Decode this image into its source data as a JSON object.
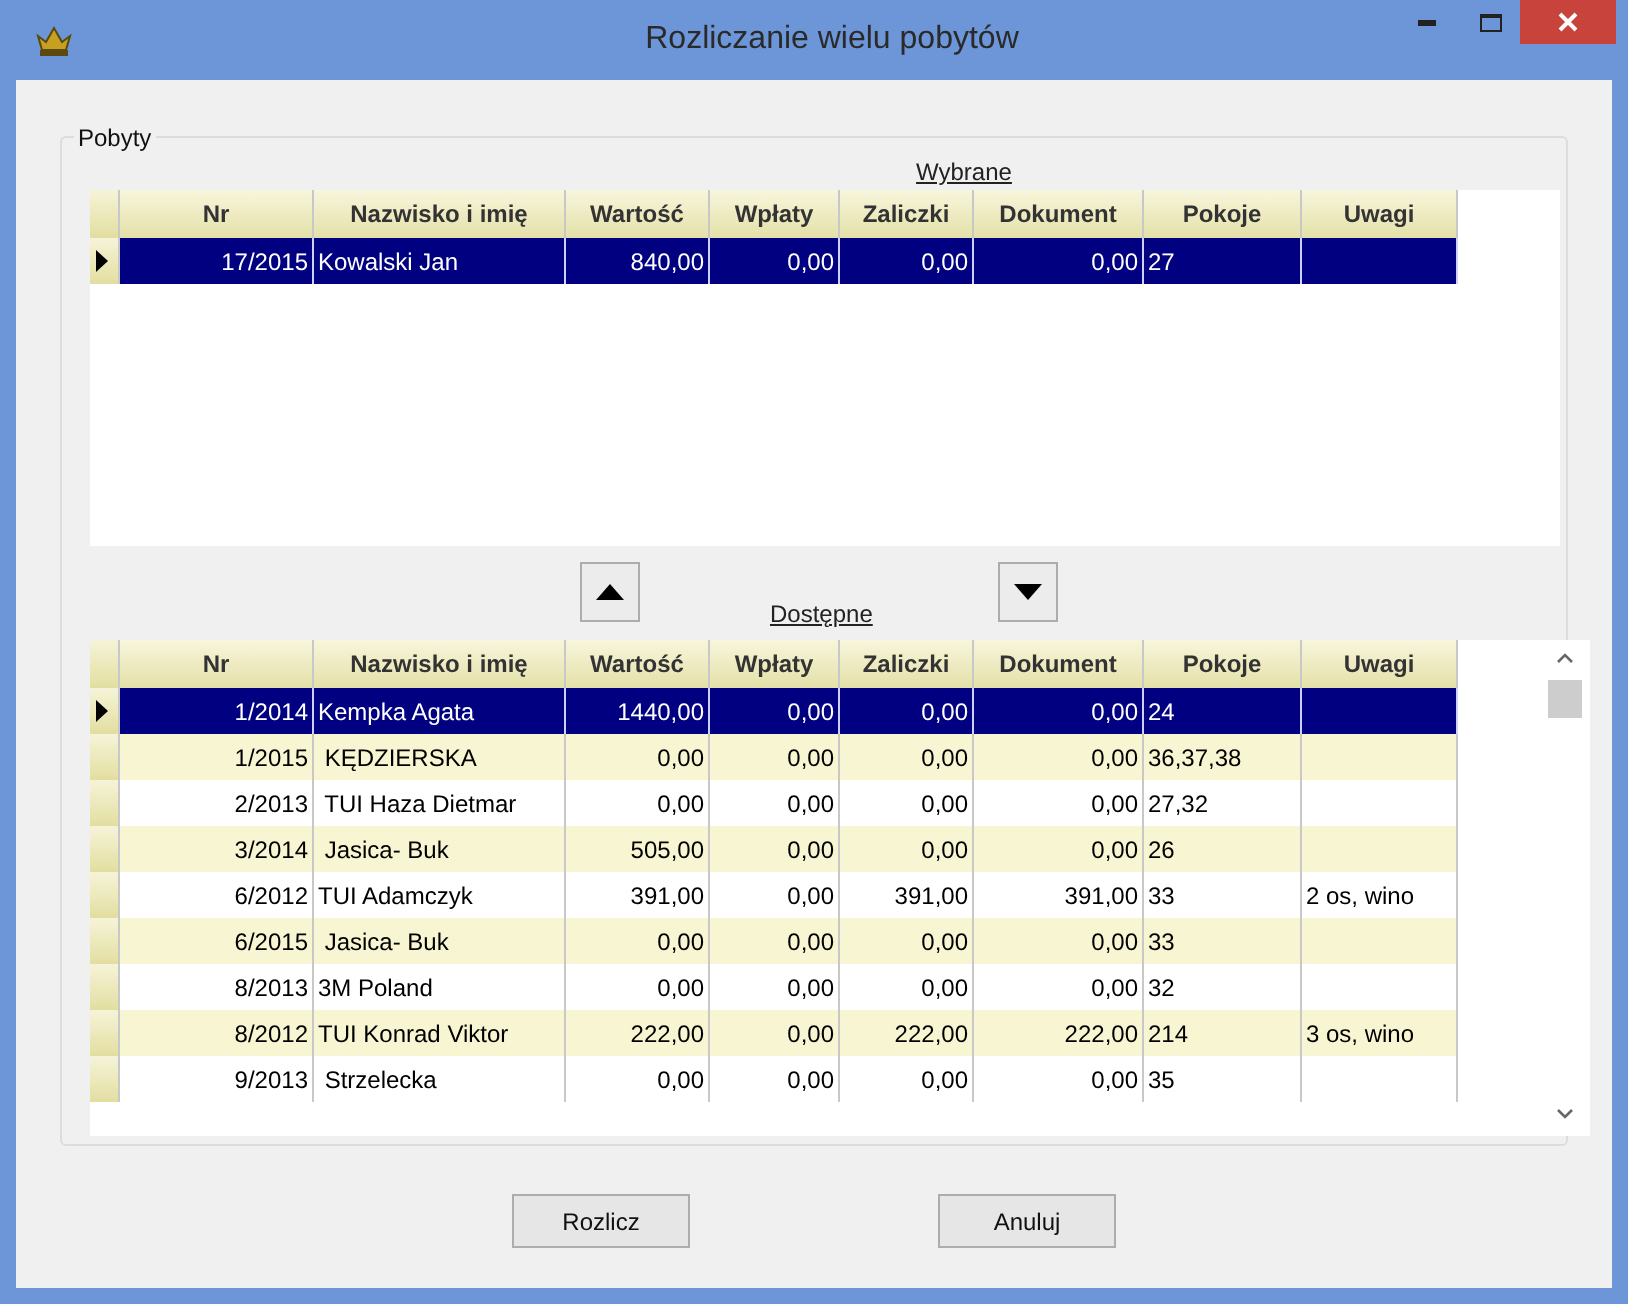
{
  "window": {
    "title": "Rozliczanie wielu pobytów"
  },
  "group": {
    "label": "Pobyty"
  },
  "selected_table": {
    "label": "Wybrane",
    "columns": [
      "Nr",
      "Nazwisko i imię",
      "Wartość",
      "Wpłaty",
      "Zaliczki",
      "Dokument",
      "Pokoje",
      "Uwagi"
    ],
    "rows": [
      {
        "nr": "17/2015",
        "name": "Kowalski Jan",
        "wartosc": "840,00",
        "wplaty": "0,00",
        "zaliczki": "0,00",
        "dokument": "0,00",
        "pokoje": "27",
        "selected": true
      }
    ]
  },
  "available_table": {
    "label": "Dostępne",
    "columns": [
      "Nr",
      "Nazwisko i imię",
      "Wartość",
      "Wpłaty",
      "Zaliczki",
      "Dokument",
      "Pokoje",
      "Uwagi"
    ],
    "rows": [
      {
        "nr": "1/2014",
        "name": "Kempka Agata",
        "wartosc": "1440,00",
        "wplaty": "0,00",
        "zaliczki": "0,00",
        "dokument": "0,00",
        "pokoje": "24",
        "selected": true
      },
      {
        "nr": "1/2015",
        "name": " KĘDZIERSKA",
        "wartosc": "0,00",
        "wplaty": "0,00",
        "zaliczki": "0,00",
        "dokument": "0,00",
        "pokoje": "36,37,38",
        "selected": false
      },
      {
        "nr": "2/2013",
        "name": " TUI Haza Dietmar",
        "wartosc": "0,00",
        "wplaty": "0,00",
        "zaliczki": "0,00",
        "dokument": "0,00",
        "pokoje": "27,32",
        "selected": false
      },
      {
        "nr": "3/2014",
        "name": " Jasica- Buk",
        "wartosc": "505,00",
        "wplaty": "0,00",
        "zaliczki": "0,00",
        "dokument": "0,00",
        "pokoje": "26",
        "selected": false
      },
      {
        "nr": "6/2012",
        "name": "TUI Adamczyk",
        "wartosc": "391,00",
        "wplaty": "0,00",
        "zaliczki": "391,00",
        "dokument": "391,00",
        "pokoje": "33",
        "uwagi": "2 os, wino",
        "selected": false
      },
      {
        "nr": "6/2015",
        "name": " Jasica- Buk",
        "wartosc": "0,00",
        "wplaty": "0,00",
        "zaliczki": "0,00",
        "dokument": "0,00",
        "pokoje": "33",
        "selected": false
      },
      {
        "nr": "8/2013",
        "name": "3M Poland",
        "wartosc": "0,00",
        "wplaty": "0,00",
        "zaliczki": "0,00",
        "dokument": "0,00",
        "pokoje": "32",
        "selected": false
      },
      {
        "nr": "8/2012",
        "name": "TUI Konrad Viktor",
        "wartosc": "222,00",
        "wplaty": "0,00",
        "zaliczki": "222,00",
        "dokument": "222,00",
        "pokoje": "214",
        "uwagi": "3 os, wino",
        "selected": false
      },
      {
        "nr": "9/2013",
        "name": " Strzelecka",
        "wartosc": "0,00",
        "wplaty": "0,00",
        "zaliczki": "0,00",
        "dokument": "0,00",
        "pokoje": "35",
        "selected": false
      }
    ]
  },
  "buttons": [
    "Rozlicz",
    "Anuluj"
  ]
}
